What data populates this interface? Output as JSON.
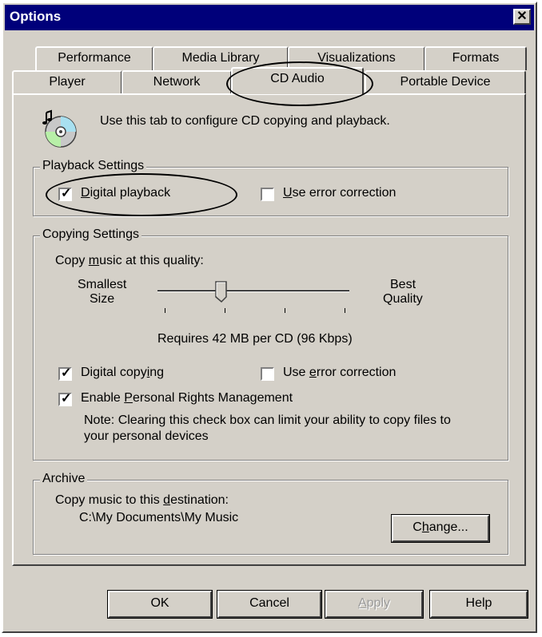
{
  "window": {
    "title": "Options"
  },
  "tabs_row1": [
    {
      "label": "Performance"
    },
    {
      "label": "Media Library"
    },
    {
      "label": "Visualizations"
    },
    {
      "label": "Formats"
    }
  ],
  "tabs_row2": [
    {
      "label": "Player"
    },
    {
      "label": "Network"
    },
    {
      "label": "CD Audio"
    },
    {
      "label": "Portable Device"
    }
  ],
  "intro": {
    "text": "Use this tab to configure CD copying and playback.",
    "icon": "cd-audio-icon"
  },
  "playback": {
    "legend": "Playback Settings",
    "digital_playback": {
      "pre": "",
      "ul": "D",
      "post": "igital playback",
      "checked": true
    },
    "error_correction": {
      "pre": "",
      "ul": "U",
      "post": "se error correction",
      "checked": false
    }
  },
  "copying": {
    "legend": "Copying Settings",
    "quality_pre": "Copy ",
    "quality_ul": "m",
    "quality_post": "usic at this quality:",
    "left_label_1": "Smallest",
    "left_label_2": "Size",
    "right_label_1": "Best",
    "right_label_2": "Quality",
    "slider_position": 0.33,
    "requires": "Requires 42 MB per CD (96 Kbps)",
    "digital_copying": {
      "pre": "Digital copy",
      "ul": "i",
      "post": "ng",
      "checked": true
    },
    "error_correction": {
      "pre": "Use ",
      "ul": "e",
      "post": "rror correction",
      "checked": false
    },
    "prm": {
      "pre": "Enable ",
      "ul": "P",
      "post": "ersonal Rights Management",
      "checked": true
    },
    "note_1": "Note: Clearing this check box can limit your ability to copy files to",
    "note_2": "your personal devices"
  },
  "archive": {
    "legend": "Archive",
    "dest_pre": "Copy music to this ",
    "dest_ul": "d",
    "dest_post": "estination:",
    "path": "C:\\My Documents\\My Music",
    "change_pre": "C",
    "change_ul": "h",
    "change_post": "ange..."
  },
  "buttons": {
    "ok": "OK",
    "cancel": "Cancel",
    "apply_ul": "A",
    "apply_post": "pply",
    "help": "Help"
  }
}
